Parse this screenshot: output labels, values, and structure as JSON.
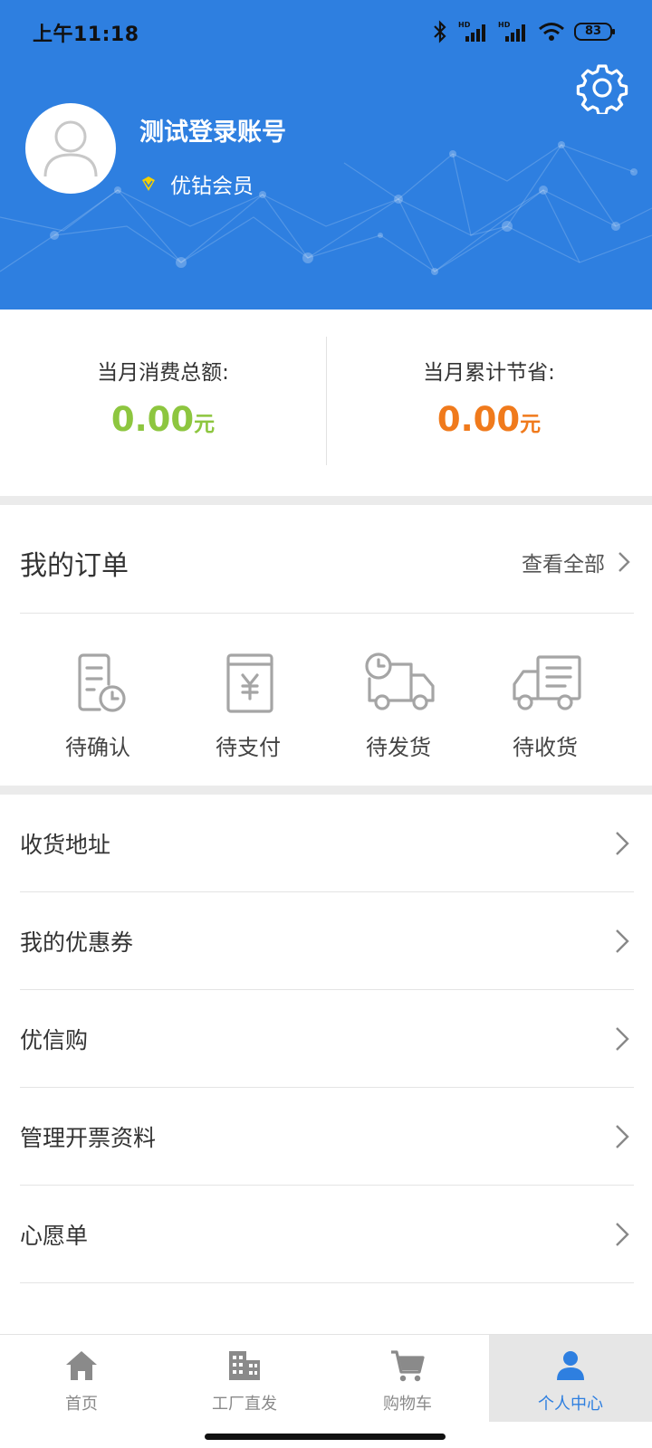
{
  "status_bar": {
    "time": "上午11:18",
    "battery": "83"
  },
  "profile": {
    "name": "测试登录账号",
    "membership": "优钻会员"
  },
  "summary": {
    "monthly_spend": {
      "label": "当月消费总额:",
      "value": "0.00",
      "unit": "元",
      "color": "#8dc63f"
    },
    "monthly_saved": {
      "label": "当月累计节省:",
      "value": "0.00",
      "unit": "元",
      "color": "#f07a1c"
    }
  },
  "orders": {
    "title": "我的订单",
    "view_all": "查看全部",
    "items": [
      {
        "label": "待确认",
        "icon": "document-clock-icon"
      },
      {
        "label": "待支付",
        "icon": "yuan-bill-icon"
      },
      {
        "label": "待发货",
        "icon": "truck-clock-icon"
      },
      {
        "label": "待收货",
        "icon": "delivery-truck-icon"
      }
    ]
  },
  "menu": [
    {
      "label": "收货地址"
    },
    {
      "label": "我的优惠券"
    },
    {
      "label": "优信购"
    },
    {
      "label": "管理开票资料"
    },
    {
      "label": "心愿单"
    }
  ],
  "tabbar": {
    "items": [
      {
        "label": "首页",
        "icon": "home-icon"
      },
      {
        "label": "工厂直发",
        "icon": "factory-building-icon"
      },
      {
        "label": "购物车",
        "icon": "cart-icon"
      },
      {
        "label": "个人中心",
        "icon": "person-icon"
      }
    ],
    "active_color": "#2e7fe0"
  },
  "colors": {
    "header": "#2e7fe0"
  }
}
